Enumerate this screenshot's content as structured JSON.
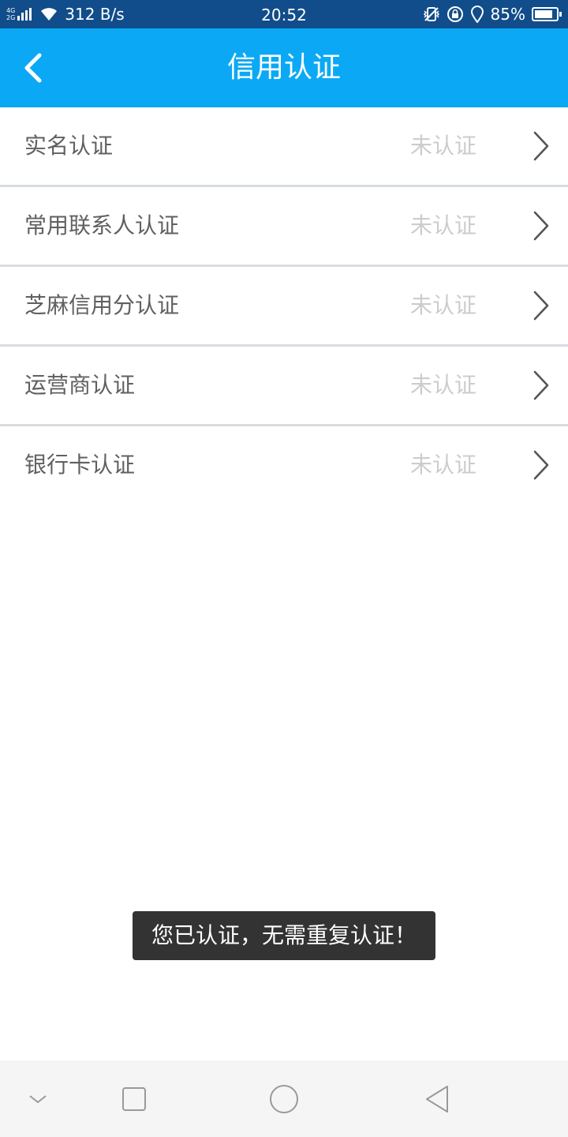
{
  "status_bar": {
    "net_type_top": "4G",
    "net_type_bottom": "2G",
    "net_speed": "312 B/s",
    "time": "20:52",
    "battery_percent": "85%",
    "battery_level": 0.85,
    "icons": [
      "signal-icon",
      "wifi-icon",
      "vibrate-icon",
      "rotation-lock-icon",
      "location-icon",
      "battery-icon"
    ]
  },
  "header": {
    "title": "信用认证",
    "back_icon": "back-arrow-icon",
    "background_color": "#0ba9f5"
  },
  "cert_items": [
    {
      "label": "实名认证",
      "status": "未认证"
    },
    {
      "label": "常用联系人认证",
      "status": "未认证"
    },
    {
      "label": "芝麻信用分认证",
      "status": "未认证"
    },
    {
      "label": "运营商认证",
      "status": "未认证"
    },
    {
      "label": "银行卡认证",
      "status": "未认证"
    }
  ],
  "toast": {
    "message": "您已认证，无需重复认证！"
  },
  "nav_bar": {
    "buttons": [
      "collapse-icon",
      "recents-icon",
      "home-icon",
      "back-icon"
    ]
  }
}
